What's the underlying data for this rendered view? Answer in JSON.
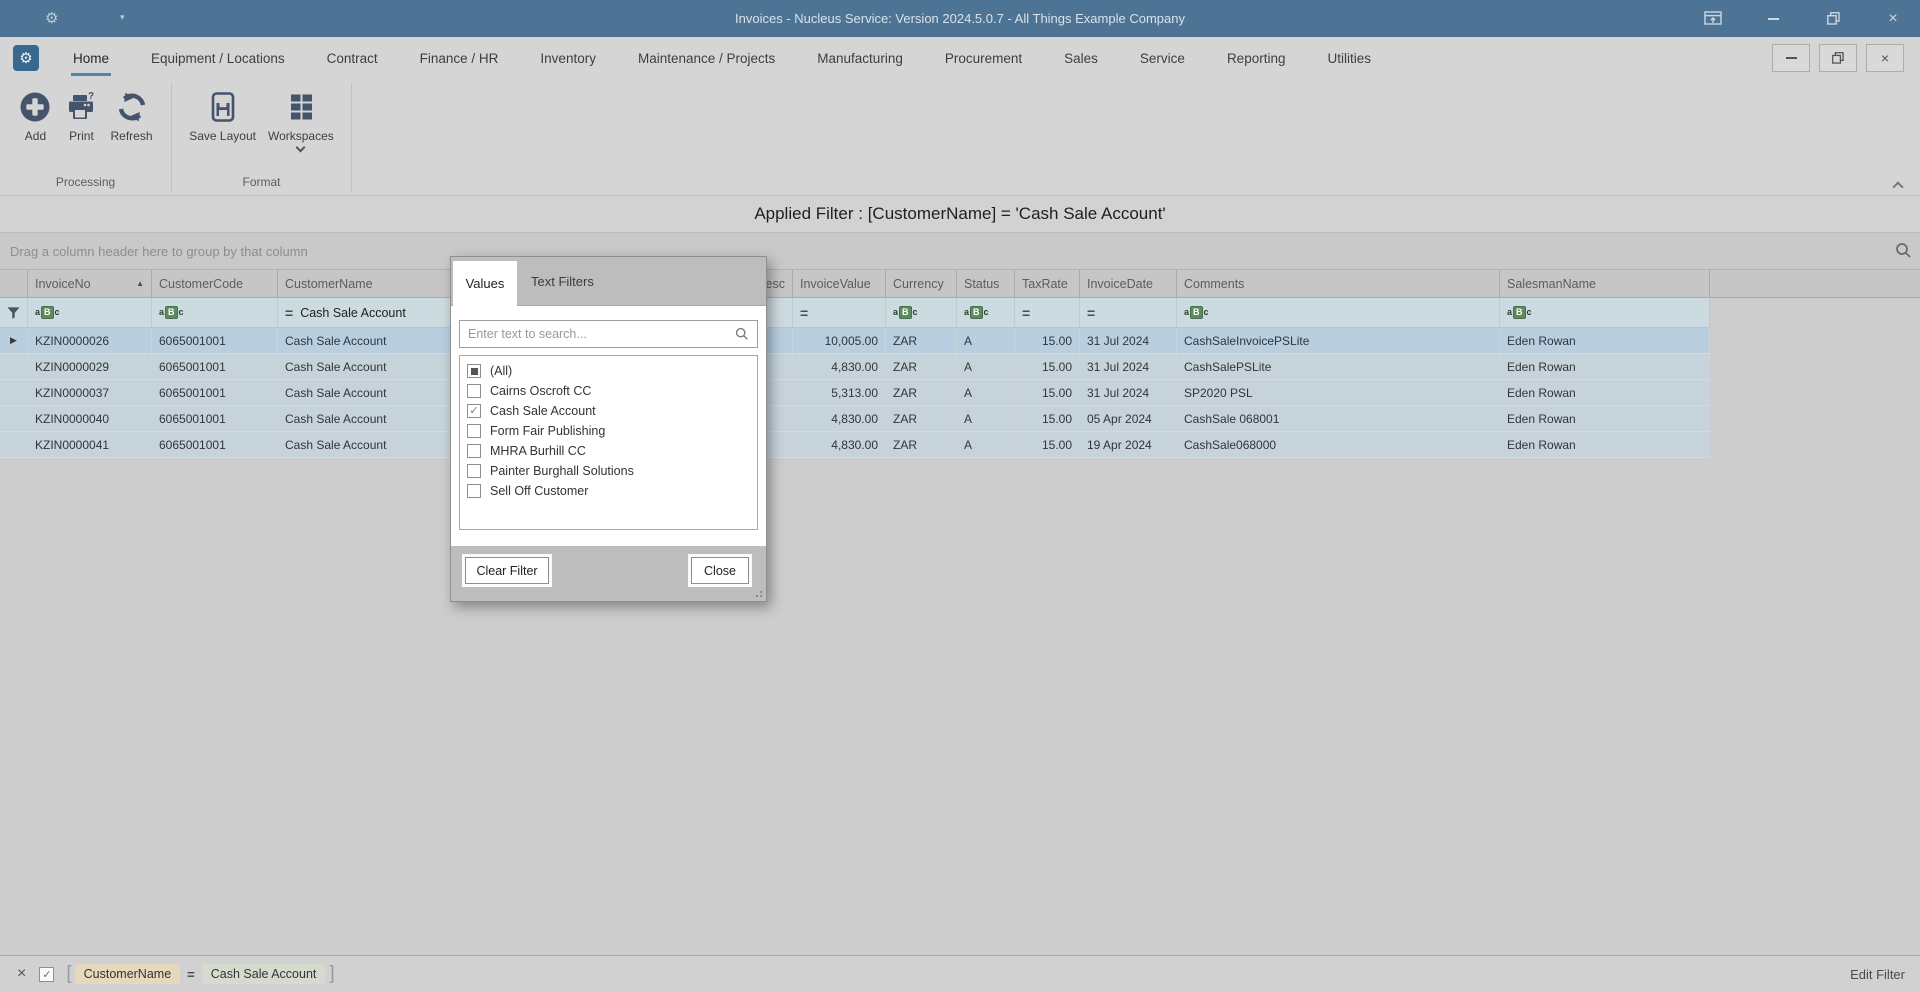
{
  "window": {
    "title": "Invoices - Nucleus Service: Version 2024.5.0.7 - All Things Example Company"
  },
  "ribbon": {
    "tabs": [
      "Home",
      "Equipment / Locations",
      "Contract",
      "Finance / HR",
      "Inventory",
      "Maintenance / Projects",
      "Manufacturing",
      "Procurement",
      "Sales",
      "Service",
      "Reporting",
      "Utilities"
    ],
    "active_tab": "Home",
    "groups": [
      {
        "label": "Processing",
        "buttons": [
          {
            "label": "Add",
            "icon": "add-icon"
          },
          {
            "label": "Print",
            "icon": "print-icon"
          },
          {
            "label": "Refresh",
            "icon": "refresh-icon"
          }
        ]
      },
      {
        "label": "Format",
        "buttons": [
          {
            "label": "Save Layout",
            "icon": "save-layout-icon"
          },
          {
            "label": "Workspaces",
            "icon": "workspaces-icon",
            "has_dropdown": true
          }
        ]
      }
    ]
  },
  "applied_filter_text": "Applied Filter : [CustomerName] = 'Cash Sale Account'",
  "grid": {
    "group_hint": "Drag a column header here to group by that column",
    "columns": [
      {
        "label": "InvoiceNo",
        "sort": "asc",
        "filter": "abc"
      },
      {
        "label": "CustomerCode",
        "filter": "abc"
      },
      {
        "label": "CustomerName",
        "filter": "eq-text",
        "filter_text": "Cash Sale Account"
      },
      {
        "label": "esc",
        "filter": "none",
        "header_align": "right"
      },
      {
        "label": "InvoiceValue",
        "filter": "eq",
        "align": "right"
      },
      {
        "label": "Currency",
        "filter": "abc"
      },
      {
        "label": "Status",
        "filter": "abc"
      },
      {
        "label": "TaxRate",
        "filter": "eq",
        "align": "right"
      },
      {
        "label": "InvoiceDate",
        "filter": "eq"
      },
      {
        "label": "Comments",
        "filter": "abc"
      },
      {
        "label": "SalesmanName",
        "filter": "abc"
      }
    ],
    "rows": [
      {
        "selected": true,
        "cells": [
          "KZIN0000026",
          "6065001001",
          "Cash Sale Account",
          "",
          "10,005.00",
          "ZAR",
          "A",
          "15.00",
          "31 Jul 2024",
          "CashSaleInvoicePSLite",
          "Eden Rowan"
        ]
      },
      {
        "selected": false,
        "cells": [
          "KZIN0000029",
          "6065001001",
          "Cash Sale Account",
          "",
          "4,830.00",
          "ZAR",
          "A",
          "15.00",
          "31 Jul 2024",
          "CashSalePSLite",
          "Eden Rowan"
        ]
      },
      {
        "selected": false,
        "cells": [
          "KZIN0000037",
          "6065001001",
          "Cash Sale Account",
          "",
          "5,313.00",
          "ZAR",
          "A",
          "15.00",
          "31 Jul 2024",
          "SP2020 PSL",
          "Eden Rowan"
        ]
      },
      {
        "selected": false,
        "cells": [
          "KZIN0000040",
          "6065001001",
          "Cash Sale Account",
          "",
          "4,830.00",
          "ZAR",
          "A",
          "15.00",
          "05 Apr 2024",
          "CashSale 068001",
          "Eden Rowan"
        ]
      },
      {
        "selected": false,
        "cells": [
          "KZIN0000041",
          "6065001001",
          "Cash Sale Account",
          "",
          "4,830.00",
          "ZAR",
          "A",
          "15.00",
          "19 Apr 2024",
          "CashSale068000",
          "Eden Rowan"
        ]
      }
    ]
  },
  "filter_popup": {
    "tabs": [
      "Values",
      "Text Filters"
    ],
    "active_tab": "Values",
    "search_placeholder": "Enter text to search...",
    "items": [
      {
        "label": "(All)",
        "state": "indeterminate"
      },
      {
        "label": "Cairns Oscroft CC",
        "state": "unchecked"
      },
      {
        "label": "Cash Sale Account",
        "state": "checked"
      },
      {
        "label": "Form Fair Publishing",
        "state": "unchecked"
      },
      {
        "label": "MHRA Burhill CC",
        "state": "unchecked"
      },
      {
        "label": "Painter Burghall Solutions",
        "state": "unchecked"
      },
      {
        "label": "Sell Off Customer",
        "state": "unchecked"
      }
    ],
    "clear_button": "Clear Filter",
    "close_button": "Close"
  },
  "status_bar": {
    "filter_field": "CustomerName",
    "operator": "=",
    "filter_value": "Cash Sale Account",
    "enabled": true,
    "edit_filter_label": "Edit Filter"
  },
  "colors": {
    "titlebar": "#4d7494",
    "active_tab_underline": "#4e86ad",
    "ribbon_icon": "#44546a",
    "filter_row_bg": "#ccdbe0",
    "selected_row_bg": "#b9cfe0",
    "row_bg": "#c6d3db",
    "abc_badge_green": "#5d8a5f",
    "chip_field_bg": "#e5d8bc",
    "chip_value_bg": "#d5dccf"
  }
}
